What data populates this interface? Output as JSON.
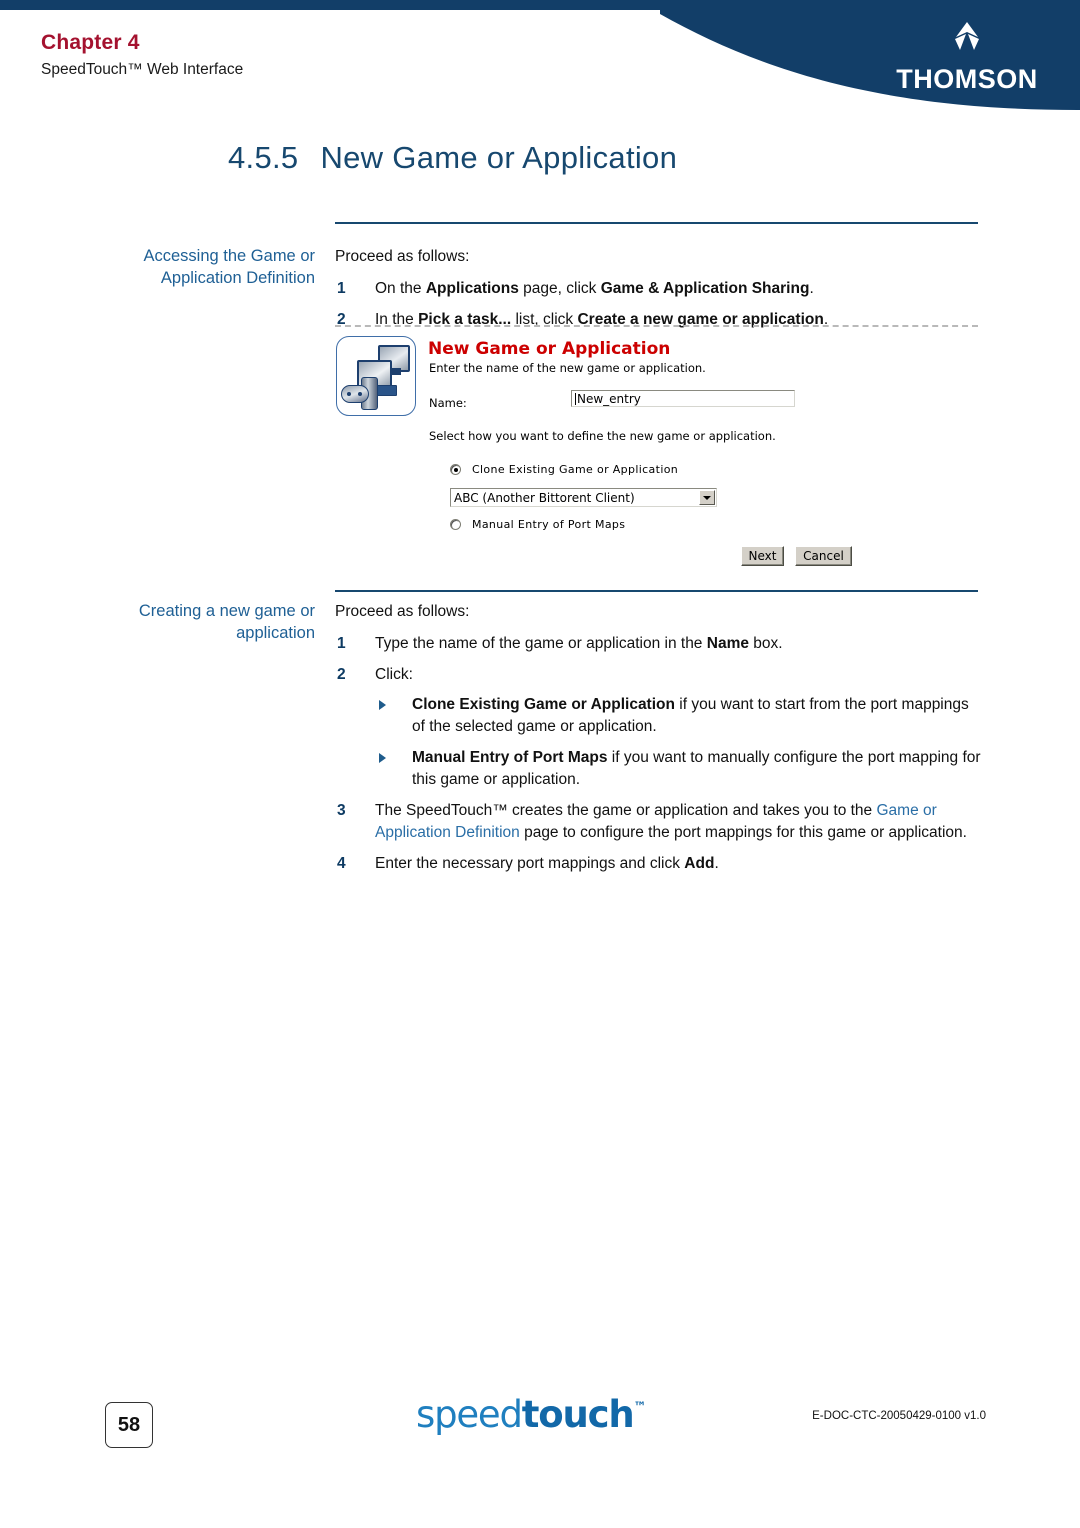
{
  "header": {
    "chapter": "Chapter 4",
    "subtitle": "SpeedTouch™ Web Interface",
    "brand": "THOMSON",
    "brand_color": "#123E68",
    "chapter_color": "#A4122F"
  },
  "section": {
    "number": "4.5.5",
    "title": "New Game or Application"
  },
  "block1": {
    "side_label_line1": "Accessing the Game or",
    "side_label_line2": "Application Definition",
    "lead": "Proceed as follows:",
    "steps": [
      {
        "n": "1",
        "parts": [
          {
            "t": "On the ",
            "b": false
          },
          {
            "t": "Applications",
            "b": true
          },
          {
            "t": " page, click ",
            "b": false
          },
          {
            "t": "Game & Application Sharing",
            "b": true
          },
          {
            "t": ".",
            "b": false
          }
        ]
      },
      {
        "n": "2",
        "parts": [
          {
            "t": "In the ",
            "b": false
          },
          {
            "t": "Pick a task...",
            "b": true
          },
          {
            "t": " list, click ",
            "b": false
          },
          {
            "t": "Create a new game or application",
            "b": true
          },
          {
            "t": ".",
            "b": false
          }
        ]
      }
    ]
  },
  "screenshot": {
    "icon_name": "game-and-computers-icon",
    "title": "New Game or Application",
    "title_color": "#CC0000",
    "subtitle": "Enter the name of the new game or application.",
    "name_label": "Name:",
    "name_value": "New_entry",
    "select_hint": "Select how you want to define the new game or application.",
    "radio_clone_label": "Clone Existing Game or Application",
    "radio_clone_selected": true,
    "dropdown_value": "ABC (Another Bittorent Client)",
    "radio_manual_label": "Manual Entry of Port Maps",
    "radio_manual_selected": false,
    "next_button": "Next",
    "cancel_button": "Cancel"
  },
  "block2": {
    "side_label_line1": "Creating a new game or",
    "side_label_line2": "application",
    "lead": "Proceed as follows:",
    "step1_n": "1",
    "step1_parts": [
      {
        "t": "Type the name of the game or application in the ",
        "b": false
      },
      {
        "t": "Name",
        "b": true
      },
      {
        "t": " box.",
        "b": false
      }
    ],
    "step2_n": "2",
    "step2_text": "Click:",
    "bullets": [
      {
        "parts": [
          {
            "t": "Clone Existing Game or Application",
            "b": true
          },
          {
            "t": " if you want to start from the port mappings of the selected game or application.",
            "b": false
          }
        ]
      },
      {
        "parts": [
          {
            "t": "Manual Entry of Port Maps",
            "b": true
          },
          {
            "t": " if you want to manually configure the port mapping for this game or application.",
            "b": false
          }
        ]
      }
    ],
    "step3_n": "3",
    "step3_parts": [
      {
        "t": "The SpeedTouch™ creates the game or application and takes you to the ",
        "b": false,
        "link": false
      },
      {
        "t": "Game or Application Definition",
        "b": false,
        "link": true
      },
      {
        "t": " page to configure the port mappings for this game or application.",
        "b": false,
        "link": false
      }
    ],
    "step4_n": "4",
    "step4_parts": [
      {
        "t": "Enter the necessary port mappings and click ",
        "b": false
      },
      {
        "t": "Add",
        "b": true
      },
      {
        "t": ".",
        "b": false
      }
    ]
  },
  "footer": {
    "page_number": "58",
    "logo_light": "speed",
    "logo_bold": "touch",
    "logo_tm": "™",
    "doc_id": "E-DOC-CTC-20050429-0100 v1.0"
  }
}
